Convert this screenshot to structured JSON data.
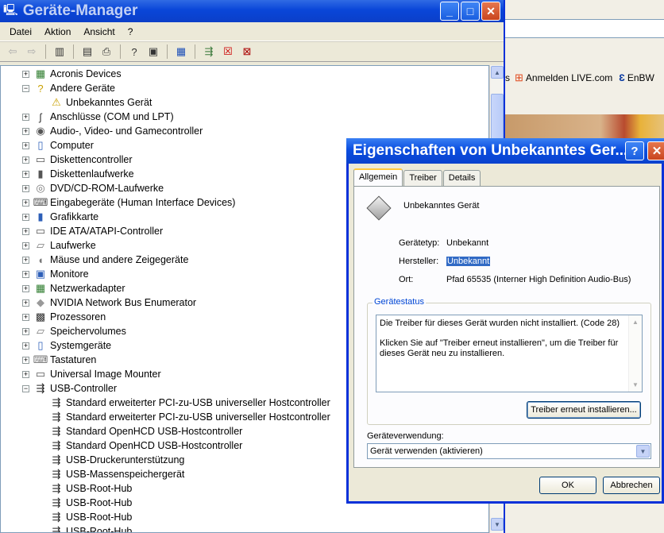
{
  "browser": {
    "links": [
      {
        "icon": "windows-flag-icon",
        "label": "Anmelden LIVE.com"
      },
      {
        "icon": "enbw-logo-icon",
        "label": "EnBW"
      }
    ],
    "partial_link": "s"
  },
  "window": {
    "title": "Geräte-Manager",
    "menu": [
      "Datei",
      "Aktion",
      "Ansicht",
      "?"
    ]
  },
  "tree": [
    {
      "label": "Acronis Devices",
      "expander": "+",
      "icon": "board-icon",
      "level": 0
    },
    {
      "label": "Andere Geräte",
      "expander": "−",
      "icon": "question-icon",
      "level": 0
    },
    {
      "label": "Unbekanntes Gerät",
      "expander": "",
      "icon": "warning-question-icon",
      "level": 1
    },
    {
      "label": "Anschlüsse (COM und LPT)",
      "expander": "+",
      "icon": "port-icon",
      "level": 0
    },
    {
      "label": "Audio-, Video- und Gamecontroller",
      "expander": "+",
      "icon": "speaker-icon",
      "level": 0
    },
    {
      "label": "Computer",
      "expander": "+",
      "icon": "computer-icon",
      "level": 0
    },
    {
      "label": "Diskettencontroller",
      "expander": "+",
      "icon": "controller-icon",
      "level": 0
    },
    {
      "label": "Diskettenlaufwerke",
      "expander": "+",
      "icon": "floppy-icon",
      "level": 0
    },
    {
      "label": "DVD/CD-ROM-Laufwerke",
      "expander": "+",
      "icon": "cd-icon",
      "level": 0
    },
    {
      "label": "Eingabegeräte (Human Interface Devices)",
      "expander": "+",
      "icon": "hid-icon",
      "level": 0
    },
    {
      "label": "Grafikkarte",
      "expander": "+",
      "icon": "display-icon",
      "level": 0
    },
    {
      "label": "IDE ATA/ATAPI-Controller",
      "expander": "+",
      "icon": "ide-icon",
      "level": 0
    },
    {
      "label": "Laufwerke",
      "expander": "+",
      "icon": "drive-icon",
      "level": 0
    },
    {
      "label": "Mäuse und andere Zeigegeräte",
      "expander": "+",
      "icon": "mouse-icon",
      "level": 0
    },
    {
      "label": "Monitore",
      "expander": "+",
      "icon": "monitor-icon",
      "level": 0
    },
    {
      "label": "Netzwerkadapter",
      "expander": "+",
      "icon": "network-icon",
      "level": 0
    },
    {
      "label": "NVIDIA Network Bus Enumerator",
      "expander": "+",
      "icon": "diamond-icon",
      "level": 0
    },
    {
      "label": "Prozessoren",
      "expander": "+",
      "icon": "cpu-icon",
      "level": 0
    },
    {
      "label": "Speichervolumes",
      "expander": "+",
      "icon": "volume-icon",
      "level": 0
    },
    {
      "label": "Systemgeräte",
      "expander": "+",
      "icon": "system-icon",
      "level": 0
    },
    {
      "label": "Tastaturen",
      "expander": "+",
      "icon": "keyboard-icon",
      "level": 0
    },
    {
      "label": "Universal Image Mounter",
      "expander": "+",
      "icon": "mounter-icon",
      "level": 0
    },
    {
      "label": "USB-Controller",
      "expander": "−",
      "icon": "usb-icon",
      "level": 0
    },
    {
      "label": "Standard erweiterter PCI-zu-USB universeller Hostcontroller",
      "expander": "",
      "icon": "usb-icon",
      "level": 1
    },
    {
      "label": "Standard erweiterter PCI-zu-USB universeller Hostcontroller",
      "expander": "",
      "icon": "usb-icon",
      "level": 1
    },
    {
      "label": "Standard OpenHCD USB-Hostcontroller",
      "expander": "",
      "icon": "usb-icon",
      "level": 1
    },
    {
      "label": "Standard OpenHCD USB-Hostcontroller",
      "expander": "",
      "icon": "usb-icon",
      "level": 1
    },
    {
      "label": "USB-Druckerunterstützung",
      "expander": "",
      "icon": "usb-icon",
      "level": 1
    },
    {
      "label": "USB-Massenspeichergerät",
      "expander": "",
      "icon": "usb-icon",
      "level": 1
    },
    {
      "label": "USB-Root-Hub",
      "expander": "",
      "icon": "usb-icon",
      "level": 1
    },
    {
      "label": "USB-Root-Hub",
      "expander": "",
      "icon": "usb-icon",
      "level": 1
    },
    {
      "label": "USB-Root-Hub",
      "expander": "",
      "icon": "usb-icon",
      "level": 1
    },
    {
      "label": "USB-Root-Hub",
      "expander": "",
      "icon": "usb-icon",
      "level": 1
    }
  ],
  "dialog": {
    "title": "Eigenschaften von Unbekanntes Gerät",
    "title_display": "Eigenschaften von Unbekanntes Ger...",
    "tabs": [
      "Allgemein",
      "Treiber",
      "Details"
    ],
    "device_name": "Unbekanntes Gerät",
    "props": [
      {
        "label": "Gerätetyp:",
        "value": "Unbekannt",
        "selected": false
      },
      {
        "label": "Hersteller:",
        "value": "Unbekannt",
        "selected": true
      },
      {
        "label": "Ort:",
        "value": "Pfad 65535 (Interner High Definition Audio-Bus)",
        "selected": false
      }
    ],
    "status_group": "Gerätestatus",
    "status_line1": "Die Treiber für dieses Gerät wurden nicht installiert. (Code 28)",
    "status_line2": "Klicken Sie auf \"Treiber erneut installieren\", um die Treiber für dieses Gerät neu zu installieren.",
    "reinstall_button": "Treiber erneut installieren...",
    "usage_label": "Geräteverwendung:",
    "usage_value": "Gerät verwenden (aktivieren)",
    "ok": "OK",
    "cancel": "Abbrechen"
  },
  "colors": {
    "titlebar": "#0a46d8",
    "desktop": "#3a6ea5",
    "selection": "#316ac5",
    "group_title": "#0046d5"
  }
}
